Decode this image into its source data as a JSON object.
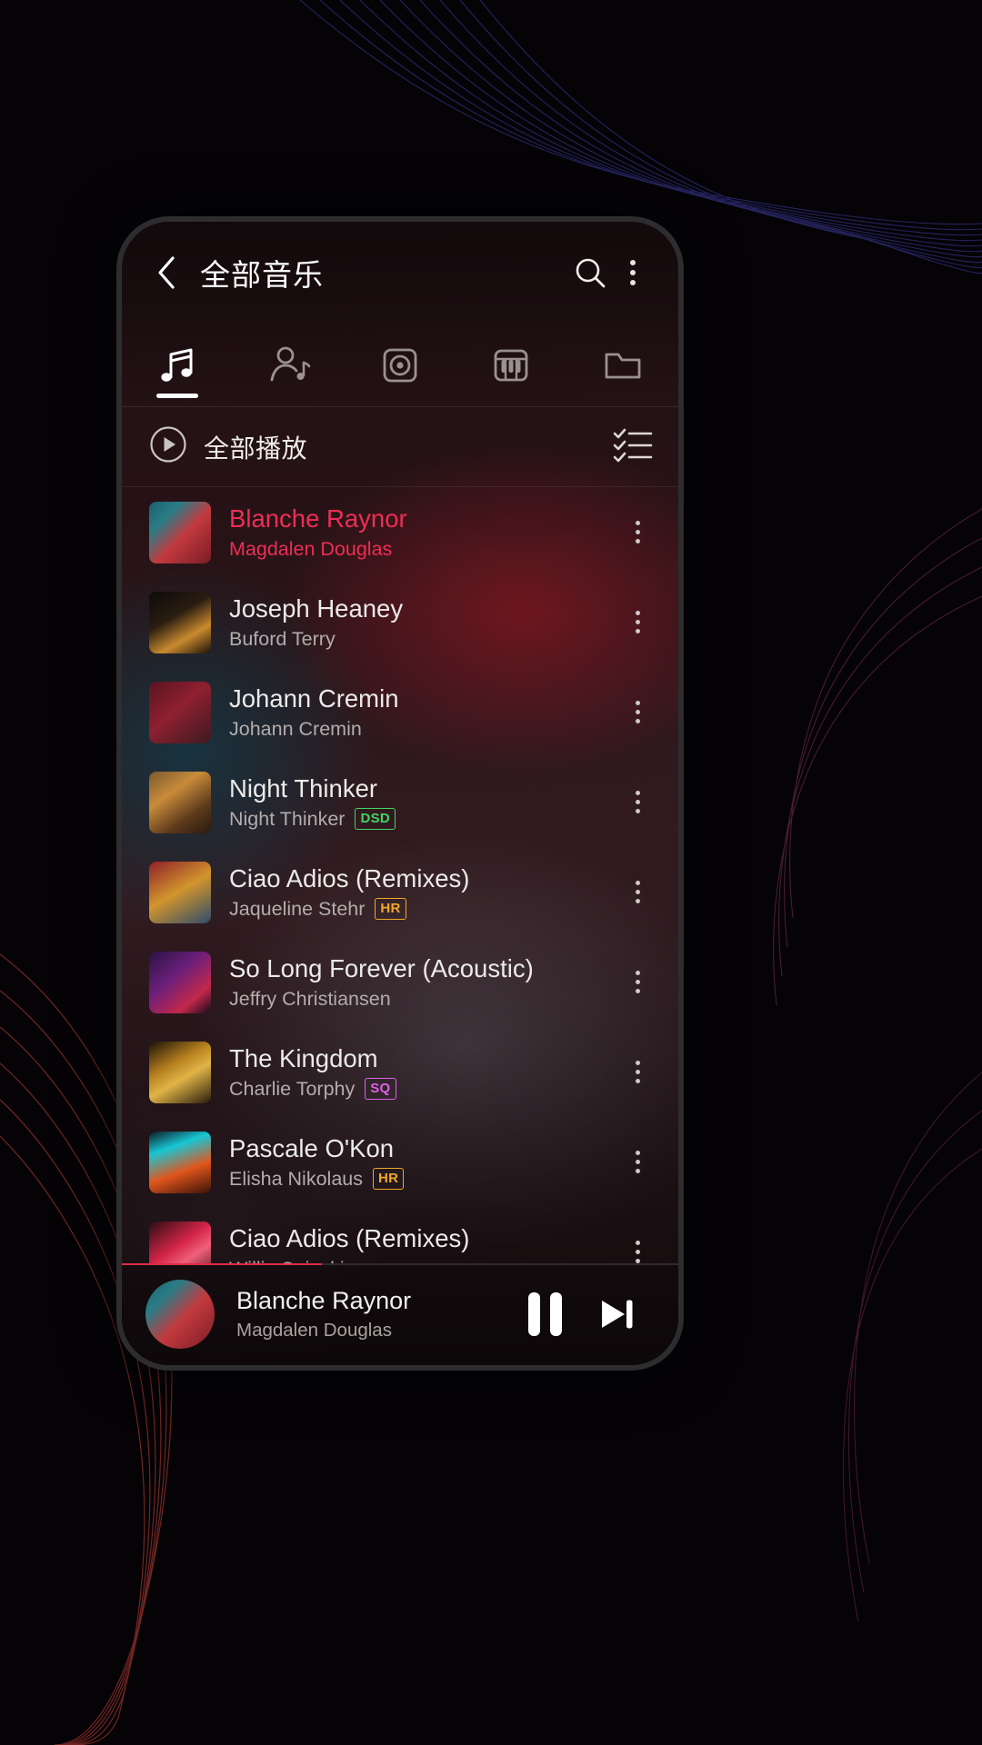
{
  "header": {
    "title": "全部音乐",
    "back_icon": "chevron-left-icon",
    "search_icon": "search-icon",
    "more_icon": "more-vertical-icon"
  },
  "tabs": [
    {
      "name": "songs",
      "icon": "music-note-icon",
      "active": true
    },
    {
      "name": "artists",
      "icon": "artist-icon",
      "active": false
    },
    {
      "name": "albums",
      "icon": "album-disc-icon",
      "active": false
    },
    {
      "name": "genres",
      "icon": "piano-icon",
      "active": false
    },
    {
      "name": "folders",
      "icon": "folder-icon",
      "active": false
    }
  ],
  "play_all": {
    "label": "全部播放",
    "play_icon": "play-circle-icon",
    "select_icon": "multi-select-icon"
  },
  "songs": [
    {
      "title": "Blanche Raynor",
      "artist": "Magdalen Douglas",
      "badge": "",
      "playing": true,
      "art": "linear-gradient(135deg,#1d5e6e 0%,#2a7d86 26%,#c23a3f 55%,#7a1c24 100%)"
    },
    {
      "title": "Joseph Heaney",
      "artist": "Buford Terry",
      "badge": "",
      "playing": false,
      "art": "linear-gradient(150deg,#0b0a0a 0%,#2a1d10 40%,#c98a2e 70%,#1a1209 100%)"
    },
    {
      "title": "Johann Cremin",
      "artist": "Johann Cremin",
      "badge": "",
      "playing": false,
      "art": "linear-gradient(140deg,#5a1320 0%,#8e2030 45%,#3c1a22 100%)"
    },
    {
      "title": "Night Thinker",
      "artist": "Night Thinker",
      "badge": "DSD",
      "playing": false,
      "art": "linear-gradient(145deg,#7a5a2e 0%,#c98b3a 35%,#5d3a1c 70%,#2a1a10 100%)"
    },
    {
      "title": "Ciao Adios (Remixes)",
      "artist": "Jaqueline Stehr",
      "badge": "HR",
      "playing": false,
      "art": "linear-gradient(150deg,#8f1f2a 0%,#d2952c 48%,#2e4a6a 100%)"
    },
    {
      "title": "So Long Forever (Acoustic)",
      "artist": "Jeffry Christiansen",
      "badge": "",
      "playing": false,
      "art": "linear-gradient(140deg,#2a1246 0%,#6b1f7a 40%,#c2284a 75%,#140a20 100%)"
    },
    {
      "title": "The Kingdom",
      "artist": "Charlie Torphy",
      "badge": "SQ",
      "playing": false,
      "art": "linear-gradient(150deg,#1a1208 0%,#b9821f 38%,#e0b447 58%,#2a1c0c 100%)"
    },
    {
      "title": "Pascale O'Kon",
      "artist": "Elisha Nikolaus",
      "badge": "HR",
      "playing": false,
      "art": "linear-gradient(160deg,#0e1a22 0%,#17c6d4 28%,#e0561c 62%,#3a1208 100%)"
    },
    {
      "title": "Ciao Adios (Remixes)",
      "artist": "Willis Osinski",
      "badge": "",
      "playing": false,
      "art": "linear-gradient(145deg,#2a0e14 0%,#d42448 42%,#f0607a 62%,#3a1018 100%)"
    }
  ],
  "now_playing": {
    "title": "Blanche Raynor",
    "artist": "Magdalen Douglas",
    "pause_icon": "pause-icon",
    "next_icon": "skip-next-icon",
    "progress_percent": 36,
    "art": "linear-gradient(135deg,#1d5e6e 0%,#2a7d86 26%,#c23a3f 55%,#7a1c24 100%)"
  },
  "colors": {
    "accent": "#ef2d55",
    "badge_dsd": "#43d463",
    "badge_hr": "#f0a828",
    "badge_sq": "#e060e8"
  }
}
